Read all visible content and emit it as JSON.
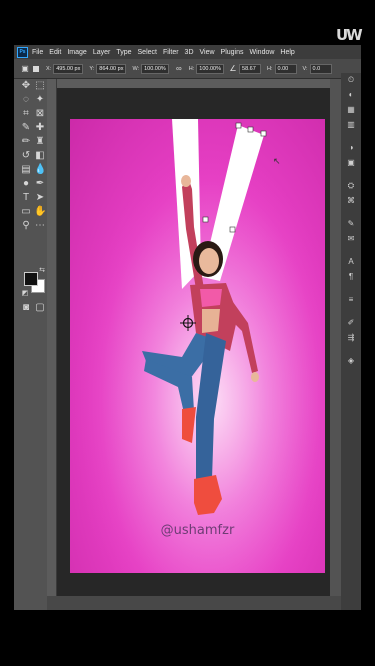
{
  "watermark": {
    "text": "UW"
  },
  "menubar": {
    "app_badge": "Ps",
    "items": [
      "File",
      "Edit",
      "Image",
      "Layer",
      "Type",
      "Select",
      "Filter",
      "3D",
      "View",
      "Plugins",
      "Window",
      "Help"
    ]
  },
  "options": {
    "x_label": "X:",
    "x_value": "495.00 px",
    "y_label": "Y:",
    "y_value": "864.00 px",
    "w_label": "W:",
    "w_value": "100.00%",
    "h_label": "H:",
    "h_value": "100.00%",
    "angle_value": "58.67",
    "hskew_label": "H:",
    "hskew_value": "0.00",
    "vskew_label": "V:",
    "vskew_value": "0.0"
  },
  "canvas": {
    "credit": "@ushamfzr",
    "colors": {
      "background": "#e63fc4",
      "stripes": "#ffffff",
      "shirt": "#c2405c",
      "jeans": "#3b6ea5",
      "shoes": "#ef4d3e"
    }
  },
  "icons": {
    "tools": [
      "move-icon",
      "marquee-icon",
      "lasso-icon",
      "magic-wand-icon",
      "crop-icon",
      "frame-icon",
      "eyedropper-icon",
      "healing-icon",
      "brush-icon",
      "stamp-icon",
      "history-brush-icon",
      "eraser-icon",
      "gradient-icon",
      "blur-icon",
      "dodge-icon",
      "pen-icon",
      "type-icon",
      "path-select-icon",
      "shape-icon",
      "hand-icon",
      "zoom-icon",
      "more-icon"
    ],
    "panels": [
      "history-icon",
      "color-icon",
      "swatches-icon",
      "gradients-icon",
      "adjustments-icon",
      "libraries-icon",
      "properties-icon",
      "paths-icon",
      "brush-settings-icon",
      "comments-icon",
      "character-icon",
      "paragraph-icon",
      "align-icon",
      "brushes-icon",
      "channels-icon",
      "layers-icon"
    ]
  }
}
